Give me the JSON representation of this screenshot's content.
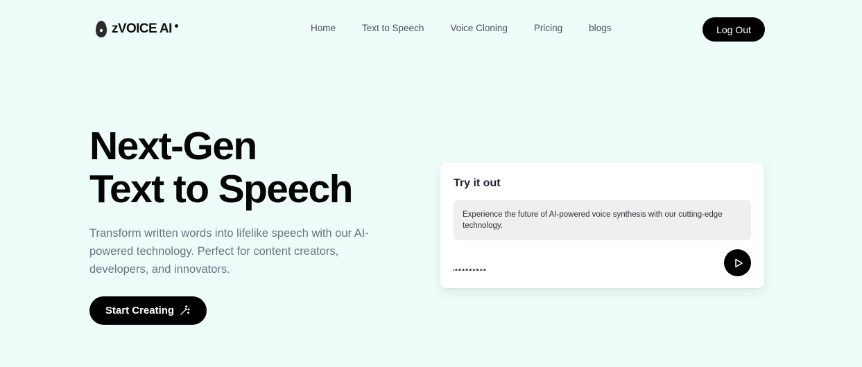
{
  "brand": {
    "name": "zVOICE AI",
    "logo_icon": "droplet-logo-icon"
  },
  "nav": {
    "items": [
      {
        "label": "Home"
      },
      {
        "label": "Text to Speech"
      },
      {
        "label": "Voice Cloning"
      },
      {
        "label": "Pricing"
      },
      {
        "label": "blogs"
      }
    ],
    "logout_label": "Log Out"
  },
  "hero": {
    "title_line1": "Next-Gen",
    "title_line2": "Text to Speech",
    "subtitle": "Transform written words into lifelike speech with our AI-powered technology. Perfect for content creators, developers, and innovators.",
    "cta_label": "Start Creating",
    "cta_icon": "magic-wand-icon"
  },
  "try_card": {
    "title": "Try it out",
    "sample_text": "Experience the future of AI-powered voice synthesis with our cutting-edge technology.",
    "play_icon": "play-icon"
  },
  "colors": {
    "background": "#effdfa",
    "primary": "#000000",
    "text_muted": "#6a7380",
    "card_input_bg": "#efefef"
  }
}
